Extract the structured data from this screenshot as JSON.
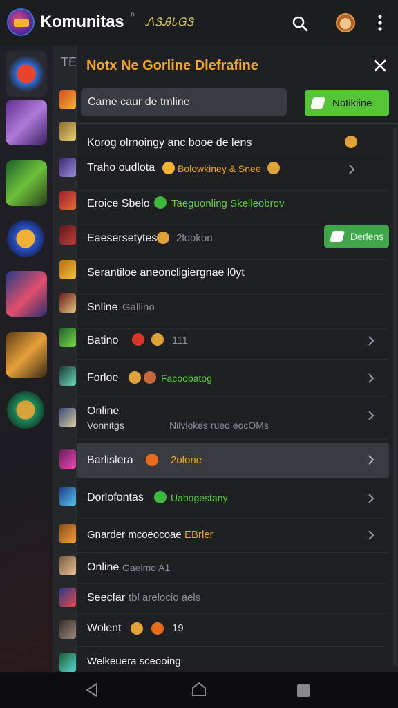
{
  "header": {
    "title": "Komunitas",
    "superscript": "ᴿ",
    "brand": "ᏁᏕᎯᏓᏀᏕ"
  },
  "rail": {
    "tab_label": "TE"
  },
  "panel": {
    "title": "Notx Ne Gorline Dlefrafine",
    "filter_value": "Came   caur de tmline",
    "notif_button": "Notikiine"
  },
  "rows": [
    {
      "label": "Korog olrnoingy anc booe de lens",
      "sub": "",
      "sub_color": "grey"
    },
    {
      "label": "Traho oudlota",
      "sub": "Bolowkiney & Snee",
      "sub_color": "yellow"
    },
    {
      "label": "Eroice Sbelo",
      "sub": "Taeguonling Skelleobrov",
      "sub_color": "green"
    },
    {
      "label": "Eaesersetytes",
      "sub": "2lookon",
      "sub_color": "grey",
      "button": "Derlens"
    },
    {
      "label": "Serantiloe aneoncligiergnae l0yt",
      "sub": "",
      "sub_color": "grey"
    },
    {
      "label": "Snline",
      "sub": "Gallino",
      "sub_color": "grey"
    },
    {
      "label": "Batino",
      "sub": "111",
      "sub_color": "grey"
    },
    {
      "label": "Forloe",
      "sub": "Facoobatog",
      "sub_color": "green"
    },
    {
      "label": "Online",
      "label2": "Vonnitgs",
      "sub": "Nilvlokes rued eocOMs",
      "sub_color": "grey"
    },
    {
      "label": "Barlislera",
      "sub": "2olone",
      "sub_color": "yellow"
    },
    {
      "label": "Dorlofontas",
      "sub": "Uabogestany",
      "sub_color": "green"
    },
    {
      "label": "Gnarder mcoeocoae",
      "sub": "EBrler",
      "sub_color": "yellow"
    },
    {
      "label": "Online",
      "sub": "Gaelmo   A1",
      "sub_color": "grey"
    },
    {
      "label": "Seecfar",
      "sub": "tbl arelocio aels",
      "sub_color": "grey"
    },
    {
      "label": "Wolent",
      "sub": "19",
      "sub_color": "white"
    },
    {
      "label": "Welkeuera sceooing",
      "sub": "",
      "sub_color": "grey"
    }
  ],
  "colors": {
    "accent_orange": "#f5a623",
    "accent_green": "#55c436",
    "background": "#1f2023"
  },
  "icons": [
    "search-icon",
    "avatar",
    "more-vertical-icon",
    "close-icon",
    "chevron-right-icon",
    "nav-back-icon",
    "nav-home-icon",
    "nav-recent-icon"
  ]
}
